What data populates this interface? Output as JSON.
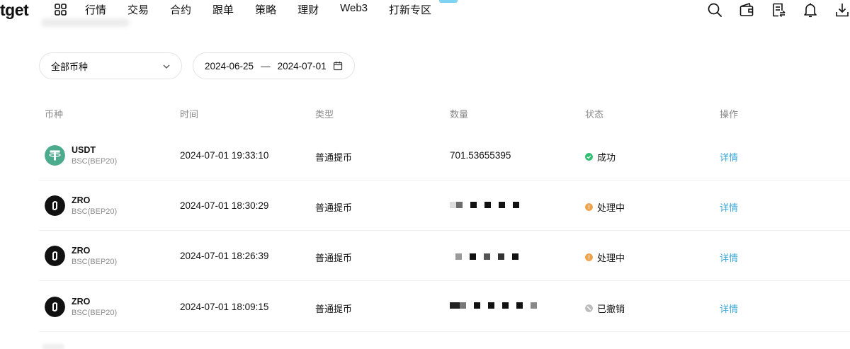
{
  "header": {
    "logo_text": "tget",
    "nav": [
      "行情",
      "交易",
      "合约",
      "跟单",
      "策略",
      "理财",
      "Web3",
      "打新专区"
    ],
    "icons": [
      "search-icon",
      "wallet-icon",
      "orders-icon",
      "bell-icon",
      "download-icon"
    ]
  },
  "filters": {
    "coin_select": "全部币种",
    "date_start": "2024-06-25",
    "date_separator": "—",
    "date_end": "2024-07-01"
  },
  "table": {
    "headers": [
      "币种",
      "时间",
      "类型",
      "数量",
      "状态",
      "操作"
    ],
    "rows": [
      {
        "coin": "USDT",
        "network": "BSC(BEP20)",
        "time": "2024-07-01 19:33:10",
        "type": "普通提币",
        "amount": "701.53655395",
        "status": "成功",
        "action": "详情"
      },
      {
        "coin": "ZRO",
        "network": "BSC(BEP20)",
        "time": "2024-07-01 18:30:29",
        "type": "普通提币",
        "amount": "",
        "status": "处理中",
        "action": "详情"
      },
      {
        "coin": "ZRO",
        "network": "BSC(BEP20)",
        "time": "2024-07-01 18:26:39",
        "type": "普通提币",
        "amount": "",
        "status": "处理中",
        "action": "详情"
      },
      {
        "coin": "ZRO",
        "network": "BSC(BEP20)",
        "time": "2024-07-01 18:09:15",
        "type": "普通提币",
        "amount": "",
        "status": "已撤销",
        "action": "详情"
      }
    ]
  },
  "colors": {
    "success": "#2fbf71",
    "processing": "#f0a24a",
    "cancelled": "#bdbdbd",
    "link": "#3aa7d6",
    "usdt": "#4bab8c"
  }
}
